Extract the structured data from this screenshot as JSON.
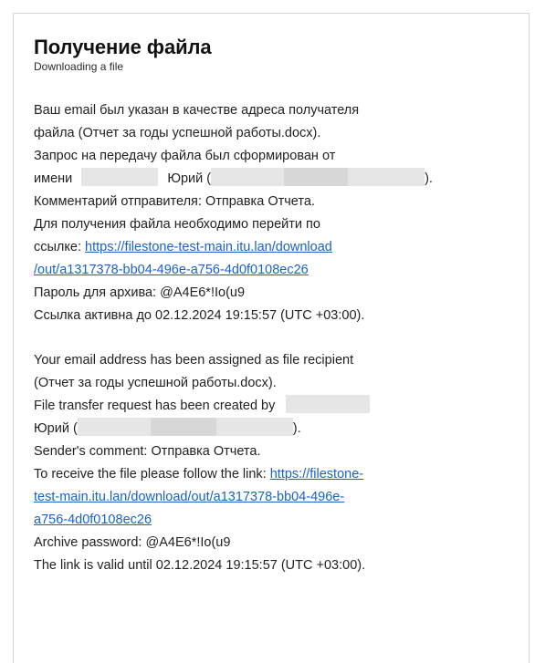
{
  "email": {
    "title": "Получение файла",
    "subtitle": "Downloading a file",
    "ru": {
      "line1": "Ваш email был указан в качестве адреса получателя",
      "line2": "файла (Отчет за годы успешной работы.docx).",
      "line3": "Запрос на передачу файла был сформирован от",
      "line4_a": "имени",
      "line4_b": "Юрий (",
      "line4_c": ").",
      "line5": "Комментарий отправителя: Отправка Отчета.",
      "line6": "Для получения файла необходимо перейти по",
      "line7_prefix": "ссылке: ",
      "link_part1": "https://filestone-test-main.itu.lan/download",
      "link_part2": "/out/a1317378-bb04-496e-a756-4d0f0108ec26",
      "line9": "Пароль для архива: @A4E6*!Io(u9",
      "line10": "Ссылка активна до 02.12.2024 19:15:57 (UTC +03:00)."
    },
    "en": {
      "line1": "Your email address has been assigned as file recipient",
      "line2": "(Отчет за годы успешной работы.docx).",
      "line3": "File transfer request has been created by",
      "line4_a": "Юрий (",
      "line4_b": ").",
      "line5": "Sender's comment: Отправка Отчета.",
      "line6_prefix": "To receive the file please follow the link: ",
      "link_part1": "https://filestone-",
      "link_part2": "test-main.itu.lan/download/out/a1317378-bb04-496e-",
      "link_part3": "a756-4d0f0108ec26",
      "line10": "Archive password: @A4E6*!Io(u9",
      "line11": "The link is valid until 02.12.2024 19:15:57 (UTC +03:00)."
    },
    "link_url": "https://filestone-test-main.itu.lan/download/out/a1317378-bb04-496e-a756-4d0f0108ec26",
    "colors": {
      "link": "#1a62c8",
      "border": "#d6d6d6",
      "redaction": "#e6e6e6"
    }
  }
}
